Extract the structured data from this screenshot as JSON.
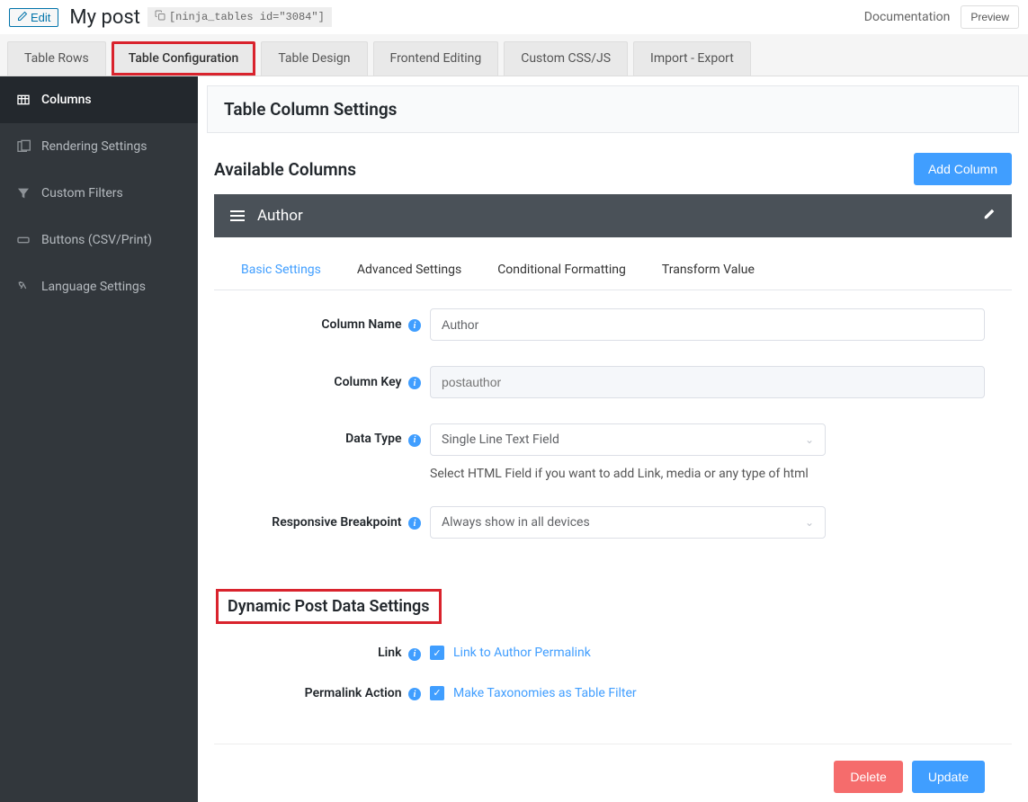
{
  "header": {
    "edit_label": "Edit",
    "title": "My post",
    "shortcode": "[ninja_tables id=\"3084\"]",
    "doc_link": "Documentation",
    "preview_btn": "Preview"
  },
  "tabs": {
    "rows": "Table Rows",
    "config": "Table Configuration",
    "design": "Table Design",
    "frontend": "Frontend Editing",
    "css": "Custom CSS/JS",
    "import": "Import - Export"
  },
  "sidebar": {
    "columns": "Columns",
    "rendering": "Rendering Settings",
    "filters": "Custom Filters",
    "buttons": "Buttons (CSV/Print)",
    "language": "Language Settings"
  },
  "content": {
    "section_title": "Table Column Settings",
    "available_title": "Available Columns",
    "add_column_btn": "Add Column",
    "column_bar_title": "Author"
  },
  "inner_tabs": {
    "basic": "Basic Settings",
    "advanced": "Advanced Settings",
    "conditional": "Conditional Formatting",
    "transform": "Transform Value"
  },
  "form": {
    "column_name_label": "Column Name",
    "column_name_value": "Author",
    "column_key_label": "Column Key",
    "column_key_placeholder": "postauthor",
    "data_type_label": "Data Type",
    "data_type_value": "Single Line Text Field",
    "data_type_helper": "Select HTML Field if you want to add Link, media or any type of html",
    "breakpoint_label": "Responsive Breakpoint",
    "breakpoint_value": "Always show in all devices",
    "dynamic_heading": "Dynamic Post Data Settings",
    "link_label": "Link",
    "link_checkbox": "Link to Author Permalink",
    "permalink_label": "Permalink Action",
    "permalink_checkbox": "Make Taxonomies as Table Filter"
  },
  "footer": {
    "delete": "Delete",
    "update": "Update"
  }
}
